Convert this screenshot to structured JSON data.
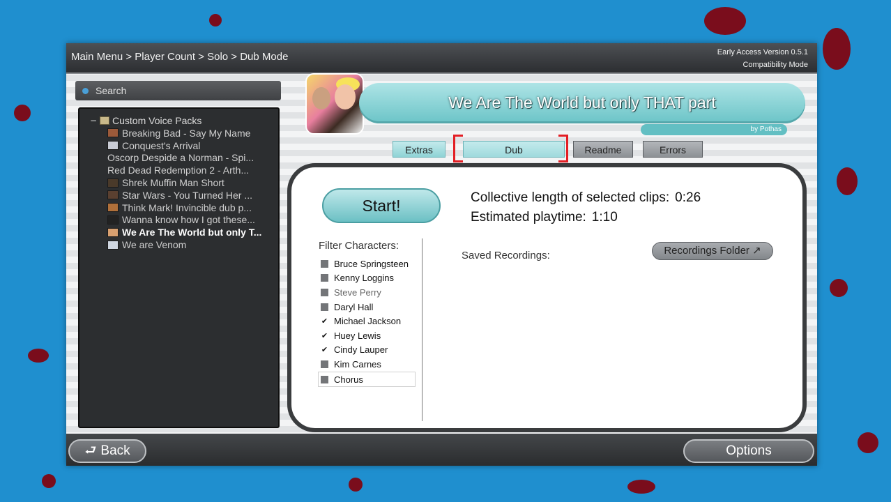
{
  "header": {
    "breadcrumb": "Main Menu > Player Count > Solo > Dub Mode",
    "version": "Early Access Version 0.5.1",
    "mode": "Compatibility Mode"
  },
  "search": {
    "label": "Search"
  },
  "tree": {
    "root": "Custom Voice Packs",
    "items": [
      {
        "label": "Breaking Bad - Say My Name",
        "thumb": "#9c5a3a"
      },
      {
        "label": "Conquest's Arrival",
        "thumb": "#c9ccd4"
      },
      {
        "label": "Oscorp Despide a Norman - Spi...",
        "thumb": ""
      },
      {
        "label": "Red Dead Redemption 2 - Arth...",
        "thumb": ""
      },
      {
        "label": "Shrek Muffin Man Short",
        "thumb": "#4a3a2a"
      },
      {
        "label": "Star Wars - You Turned Her ...",
        "thumb": "#5a4030"
      },
      {
        "label": "Think Mark! Invincible dub p...",
        "thumb": "#b0703a"
      },
      {
        "label": "Wanna know how I got these...",
        "thumb": "#222222"
      },
      {
        "label": "We Are The World but only T...",
        "thumb": "#d8a070"
      },
      {
        "label": "We are Venom",
        "thumb": "#cfd6e0"
      }
    ],
    "selected_index": 8
  },
  "pack": {
    "title": "We Are The World but only THAT part",
    "author": "by Pothas"
  },
  "tabs": {
    "extras": "Extras",
    "dub": "Dub",
    "readme": "Readme",
    "errors": "Errors"
  },
  "main": {
    "start_label": "Start!",
    "clip_length_label": "Collective length of selected clips:",
    "clip_length_value": "0:26",
    "playtime_label": "Estimated playtime:",
    "playtime_value": "1:10",
    "filter_label": "Filter Characters:",
    "characters": [
      {
        "name": "Bruce Springsteen",
        "checked": false
      },
      {
        "name": "Kenny Loggins",
        "checked": false
      },
      {
        "name": "Steve Perry",
        "checked": false
      },
      {
        "name": "Daryl Hall",
        "checked": false
      },
      {
        "name": "Michael Jackson",
        "checked": true
      },
      {
        "name": "Huey Lewis",
        "checked": true
      },
      {
        "name": "Cindy Lauper",
        "checked": true
      },
      {
        "name": "Kim Carnes",
        "checked": false
      },
      {
        "name": "Chorus",
        "checked": false
      }
    ],
    "saved_label": "Saved Recordings:",
    "recordings_folder_label": "Recordings Folder ↗"
  },
  "footer": {
    "back_label": "Back",
    "back_icon": "⮐",
    "options_label": "Options"
  },
  "colors": {
    "accent": "#6cc0c4",
    "background": "#1f8fcf",
    "splatter": "#7a0d1c"
  }
}
